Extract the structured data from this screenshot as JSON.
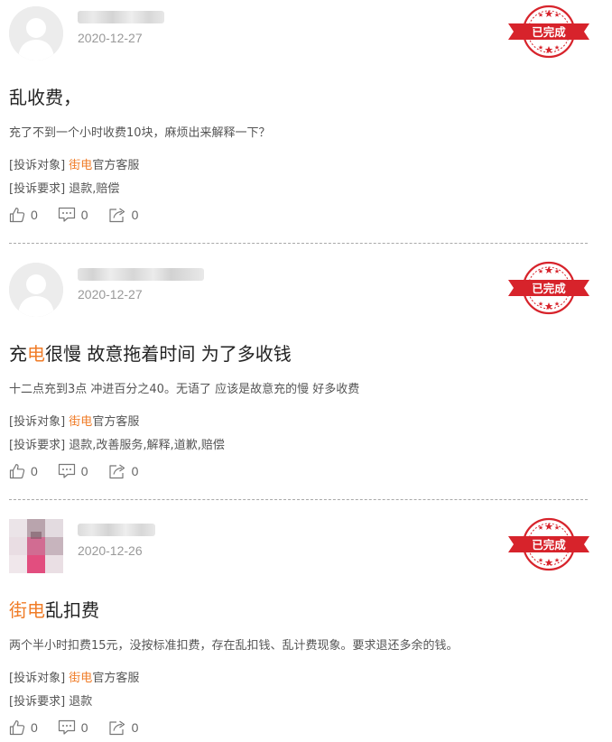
{
  "colors": {
    "accent": "#f07c27",
    "stamp_red": "#d7232b",
    "date": "#999999",
    "divider": "#a9a9a9"
  },
  "complaints": [
    {
      "date": "2020-12-27",
      "status": "已完成",
      "title_plain": "乱收费，",
      "description": "充了不到一个小时收费10块，麻烦出来解释一下？",
      "target_label": "[投诉对象]",
      "target_brand": "街电",
      "target_rest": "官方客服",
      "request_label": "[投诉要求]",
      "request_value": "退款,赔偿",
      "likes": "0",
      "comments": "0",
      "shares": "0"
    },
    {
      "date": "2020-12-27",
      "status": "已完成",
      "title_pre": "充",
      "title_hl": "电",
      "title_post": "很慢 故意拖着时间 为了多收钱",
      "description": "十二点充到3点 冲进百分之40。无语了 应该是故意充的慢 好多收费",
      "target_label": "[投诉对象]",
      "target_brand": "街电",
      "target_rest": "官方客服",
      "request_label": "[投诉要求]",
      "request_value": "退款,改善服务,解释,道歉,赔偿",
      "likes": "0",
      "comments": "0",
      "shares": "0"
    },
    {
      "date": "2020-12-26",
      "status": "已完成",
      "title_hl": "街电",
      "title_post": "乱扣费",
      "description": "两个半小时扣费15元，没按标准扣费，存在乱扣钱、乱计费现象。要求退还多余的钱。",
      "target_label": "[投诉对象]",
      "target_brand": "街电",
      "target_rest": "官方客服",
      "request_label": "[投诉要求]",
      "request_value": "退款",
      "likes": "0",
      "comments": "0",
      "shares": "0"
    }
  ]
}
